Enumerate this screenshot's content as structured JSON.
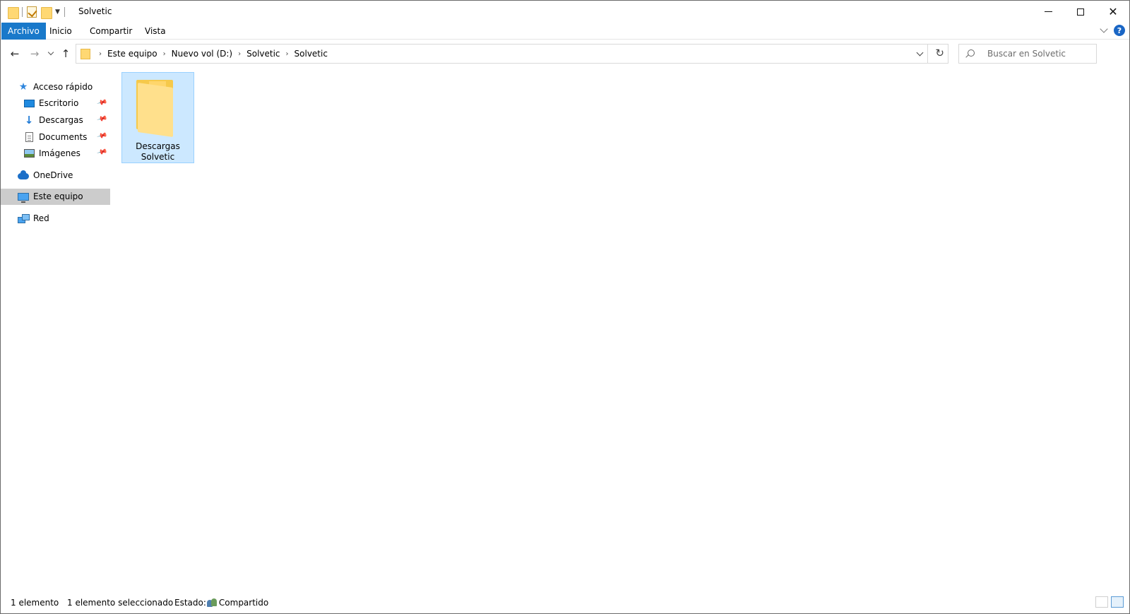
{
  "window": {
    "title": "Solvetic",
    "controls": {
      "minimize": "minimize-icon",
      "maximize": "maximize-icon",
      "close": "close-icon"
    }
  },
  "quick_access_toolbar": {
    "items": [
      "folder-icon",
      "properties-icon",
      "new-folder-icon",
      "customize-dropdown-icon"
    ]
  },
  "ribbon": {
    "tabs": [
      {
        "label": "Archivo",
        "active": true
      },
      {
        "label": "Inicio"
      },
      {
        "label": "Compartir"
      },
      {
        "label": "Vista"
      }
    ],
    "help": "?"
  },
  "address": {
    "breadcrumbs": [
      "Este equipo",
      "Nuevo vol (D:)",
      "Solvetic",
      "Solvetic"
    ],
    "search_placeholder": "Buscar en Solvetic"
  },
  "navpane": {
    "quick_access": {
      "label": "Acceso rápido",
      "items": [
        {
          "label": "Escritorio",
          "icon": "desktop-icon",
          "pinned": true
        },
        {
          "label": "Descargas",
          "icon": "downloads-icon",
          "pinned": true
        },
        {
          "label": "Documents",
          "icon": "documents-icon",
          "pinned": true
        },
        {
          "label": "Imágenes",
          "icon": "pictures-icon",
          "pinned": true
        }
      ]
    },
    "onedrive": "OneDrive",
    "this_pc": {
      "label": "Este equipo",
      "selected": true
    },
    "network": "Red"
  },
  "content": {
    "items": [
      {
        "name_line1": "Descargas",
        "name_line2": "Solvetic",
        "type": "folder",
        "selected": true
      }
    ]
  },
  "statusbar": {
    "count": "1 elemento",
    "selected": "1 elemento seleccionado",
    "state_label": "Estado:",
    "state_value": "Compartido"
  },
  "colors": {
    "accent": "#1979ca",
    "selection": "#cce8ff",
    "nav_selected": "#cccccc",
    "folder": "#ffd873"
  }
}
